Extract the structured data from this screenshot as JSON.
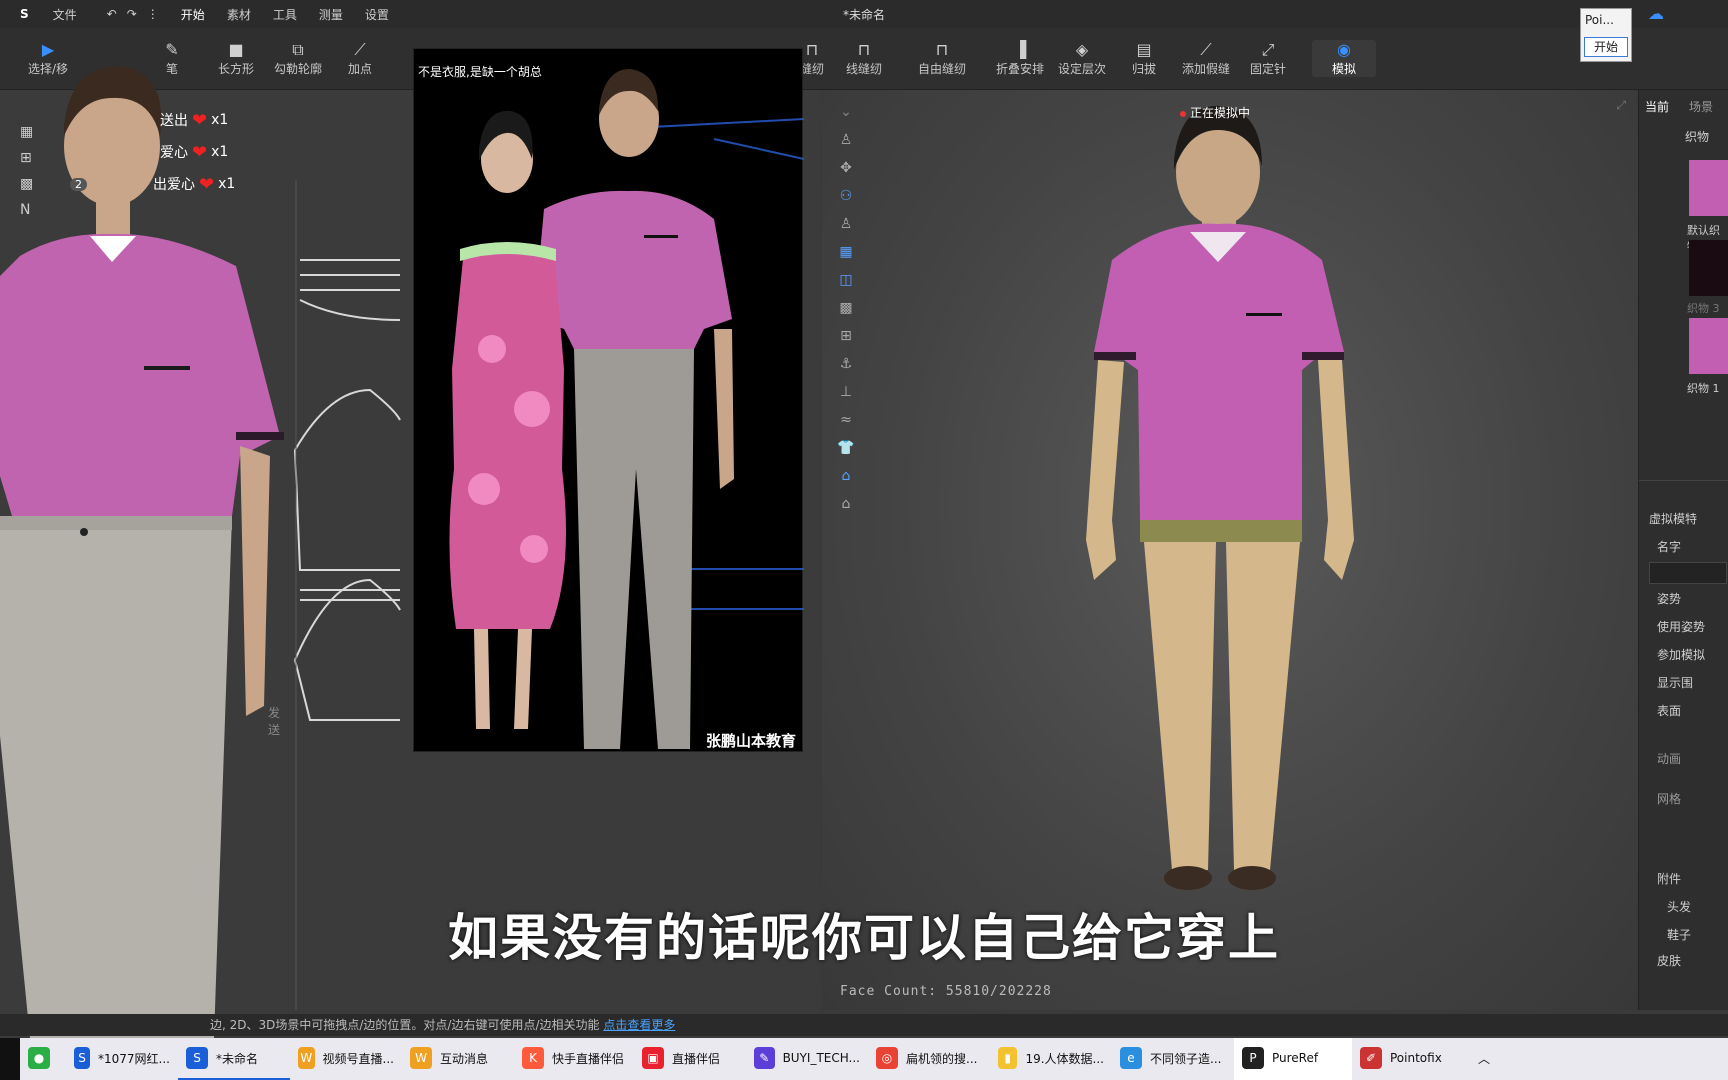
{
  "titlebar": {
    "menus": [
      "文件",
      "开始",
      "素材",
      "工具",
      "测量",
      "设置"
    ],
    "doc_title": "*未命名"
  },
  "toolbar": {
    "tools": [
      "选择/移",
      "笔",
      "长方形",
      "勾勒轮廓",
      "加点",
      "缝纫",
      "线缝纫",
      "自由缝纫",
      "折叠安排",
      "设定层次",
      "归拔",
      "添加假缝",
      "固定针",
      "模拟"
    ]
  },
  "popup": {
    "text": "Poi...",
    "button": "开始"
  },
  "video_center": {
    "caption_top": "不是衣服,是缺一个胡总",
    "watermark": "张鹏山本教育"
  },
  "chat": {
    "lines": [
      {
        "text": "x1",
        "prefix": "送出"
      },
      {
        "text": "x1",
        "prefix": "爱心"
      },
      {
        "text": "x1",
        "prefix": "出爱心",
        "level": "2"
      }
    ],
    "send_label": "发送"
  },
  "viewport": {
    "sim_badge": "正在模拟中",
    "face_count": "Face Count: 55810/202228"
  },
  "right_panel": {
    "tabs": [
      "当前",
      "场景"
    ],
    "fabric_label": "织物",
    "default_fabric": "默认织物",
    "fabric_3": "织物 3",
    "fabric_1": "织物 1",
    "section_title": "虚拟模特",
    "props": [
      "名字",
      "姿势",
      "使用姿势",
      "参加模拟",
      "显示围",
      "表面",
      "动画",
      "网格",
      "附件",
      "头发",
      "鞋子",
      "皮肤"
    ]
  },
  "subtitle": "如果没有的话呢你可以自己给它穿上",
  "status": {
    "text": "边, 2D、3D场景中可拖拽点/边的位置。对点/边右键可使用点/边相关功能",
    "link": "点击查看更多"
  },
  "taskbar": {
    "items": [
      {
        "label": "",
        "color": "#2aae45"
      },
      {
        "label": "*1077网红...",
        "color": "#1a5fd8"
      },
      {
        "label": "*未命名",
        "color": "#1a5fd8"
      },
      {
        "label": "视频号直播...",
        "color": "#f0a020"
      },
      {
        "label": "互动消息",
        "color": "#f0a020"
      },
      {
        "label": "快手直播伴侣",
        "color": "#ff5a3c"
      },
      {
        "label": "直播伴侣",
        "color": "#e8222e"
      },
      {
        "label": "BUYI_TECH...",
        "color": "#5b3fd8"
      },
      {
        "label": "扁机领的搜...",
        "color": "#e94335"
      },
      {
        "label": "19.人体数据...",
        "color": "#f2c230"
      },
      {
        "label": "不同领子造...",
        "color": "#2b8fe0"
      },
      {
        "label": "PureRef",
        "color": "#222222"
      },
      {
        "label": "Pointofix",
        "color": "#c33"
      }
    ]
  }
}
